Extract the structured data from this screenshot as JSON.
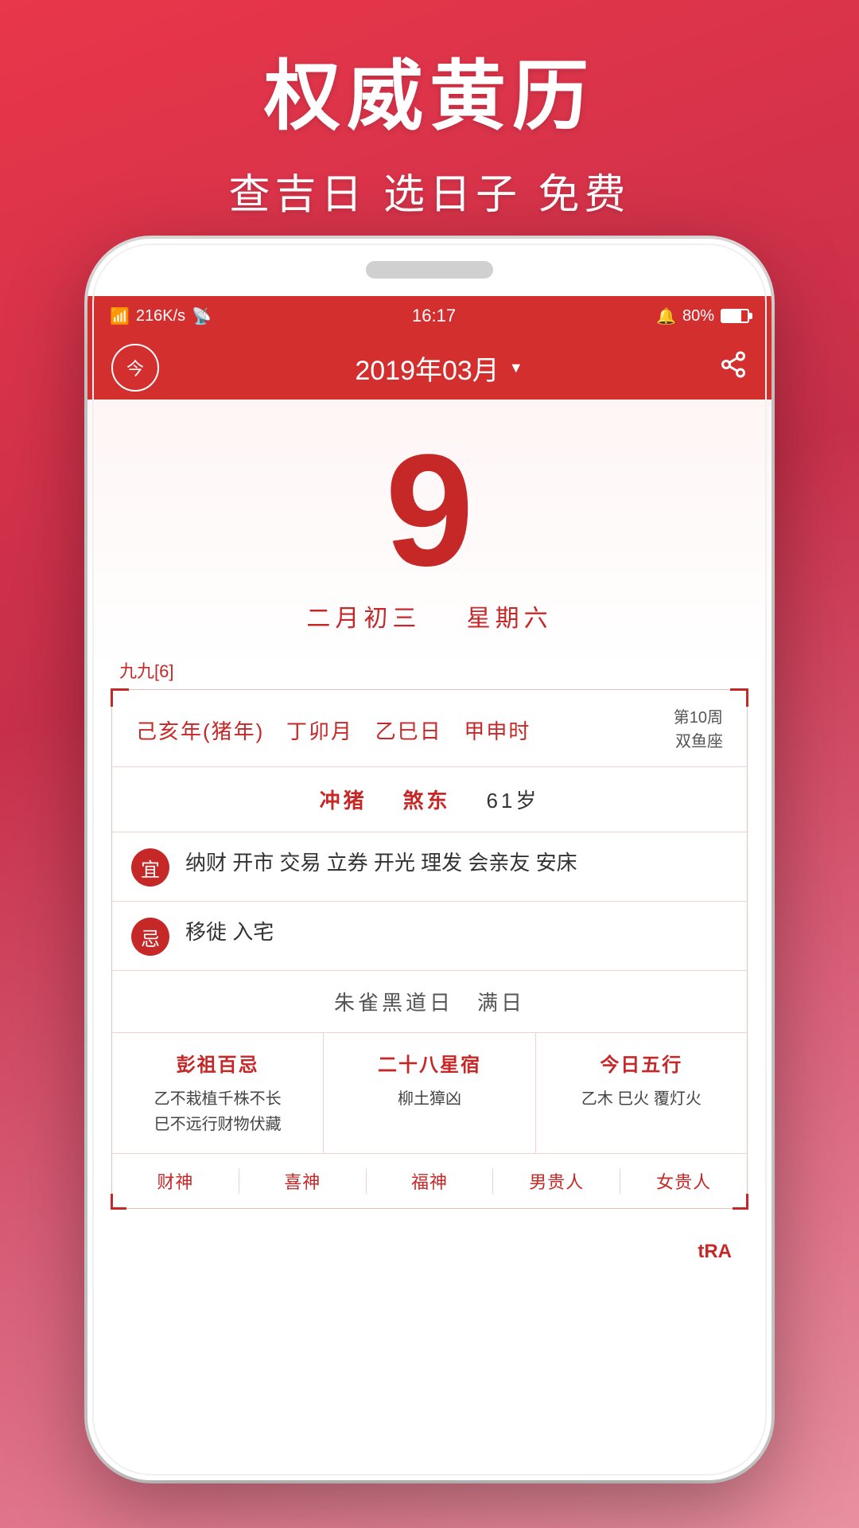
{
  "promo": {
    "title": "权威黄历",
    "subtitle": "查吉日 选日子 免费"
  },
  "status_bar": {
    "signal": "4G",
    "speed": "216K/s",
    "wifi": "WiFi",
    "time": "16:17",
    "alarm": "🔔",
    "battery_pct": "80%"
  },
  "app_header": {
    "today_label": "今",
    "month_display": "2019年03月",
    "dropdown_arrow": "▼"
  },
  "date": {
    "day": "9",
    "lunar": "二月初三",
    "weekday": "星期六"
  },
  "lunar_label": "九九[6]",
  "ganzhi": {
    "year": "己亥年(猪年)",
    "month": "丁卯月",
    "day": "乙巳日",
    "time": "甲申时",
    "week_num": "第10周",
    "zodiac": "双鱼座"
  },
  "clash": {
    "label": "冲猪",
    "direction": "煞东",
    "age": "61岁"
  },
  "yi": {
    "badge": "宜",
    "items": "纳财 开市 交易 立券 开光 理发 会亲友 安床"
  },
  "ji": {
    "badge": "忌",
    "items": "移徙 入宅"
  },
  "special_day": "朱雀黑道日　满日",
  "sections": {
    "pengzu": {
      "title": "彭祖百忌",
      "line1": "乙不栽植千株不长",
      "line2": "巳不远行财物伏藏"
    },
    "xiu": {
      "title": "二十八星宿",
      "content": "柳土獐凶"
    },
    "wuxing": {
      "title": "今日五行",
      "content": "乙木 巳火 覆灯火"
    }
  },
  "deities": [
    {
      "title": "财神",
      "value": ""
    },
    {
      "title": "喜神",
      "value": ""
    },
    {
      "title": "福神",
      "value": ""
    },
    {
      "title": "男贵人",
      "value": ""
    },
    {
      "title": "女贵人",
      "value": ""
    }
  ],
  "watermark": "tRA"
}
